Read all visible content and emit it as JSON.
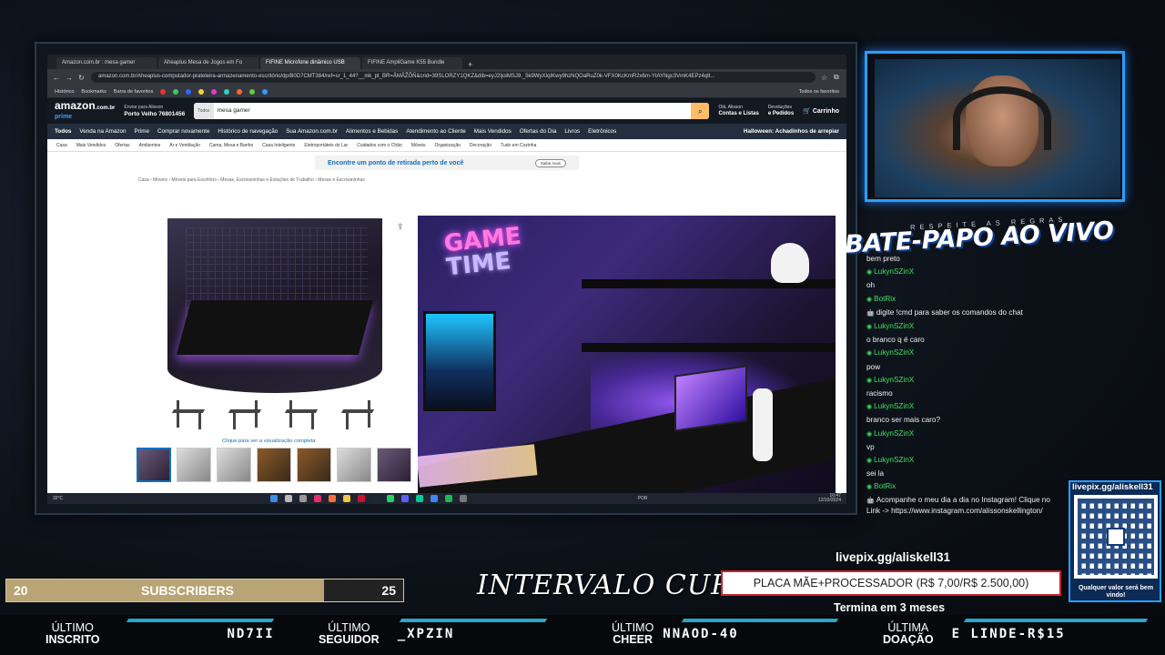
{
  "browser": {
    "tabs": [
      {
        "label": "Amazon.com.br : mesa gamer"
      },
      {
        "label": "Aheaplus Mesa de Jogos em Fo"
      },
      {
        "label": "FIFINE Microfone dinâmico USB"
      },
      {
        "label": "FIFINE AmpliGame K55 Bundle"
      }
    ],
    "url": "amazon.com.br/Aheaplus-computador-prateleira-armazenamento-escritório/dp/B0D7CMT384/ref=sr_1_44?__mk_pt_BR=ÅMÅŽÕÑ&crid=39SLORZY1QKZ&dib=eyJ2IjoiMSJ9._5k9WyXIqIKwy9hzNQOaRuZ0k-VFX0KcKmR2x6m-YtAYNgc3VmK4EPz4qIt...",
    "bookmarks": [
      "Histórico",
      "Bookmarks",
      "Barra de favoritos"
    ],
    "bookmarks_right": "Todos os favoritos"
  },
  "amazon": {
    "logo": "amazon",
    "logo_tld": ".com.br",
    "prime": "prime",
    "deliver_line1": "Enviar para Alisson",
    "deliver_line2": "Porto Velho 76801456",
    "search_category": "Todos",
    "search_value": "mesa gamer",
    "account_line1": "Olá, Alisson",
    "account_line2": "Contas e Listas",
    "returns_line1": "Devoluções",
    "returns_line2": "e Pedidos",
    "cart": "Carrinho",
    "nav": [
      "Todos",
      "Venda na Amazon",
      "Prime",
      "Comprar novamente",
      "Histórico de navegação",
      "Sua Amazon.com.br",
      "Alimentos e Bebidas",
      "Atendimento ao Cliente",
      "Mais Vendidos",
      "Ofertas do Dia",
      "Livros",
      "Eletrônicos"
    ],
    "nav_right": "Halloween: Achadinhos de arrepiar",
    "subnav": [
      "Casa",
      "Mais Vendidos",
      "Ofertas",
      "Ambientes",
      "Ar e Ventilação",
      "Cama, Mesa e Banho",
      "Casa Inteligente",
      "Eletroportáteis do Lar",
      "Cuidados com o Chão",
      "Móveis",
      "Organização",
      "Decoração",
      "Tudo em Cozinha"
    ],
    "banner_text": "Encontre um ponto de retirada perto de você",
    "banner_button": "Saiba mais",
    "breadcrumb": "Casa › Móveis › Móveis para Escritório › Mesas, Escrivaninhas e Estações de Trabalho › Mesas e Escrivaninhas",
    "view_link": "Clique para ver a visualização completa",
    "hero_neon_1": "GAME",
    "hero_neon_2": "TIME",
    "taskbar_temp": "32°C",
    "taskbar_time": "16:47",
    "taskbar_date": "12/10/2024",
    "taskbar_lang": "POR"
  },
  "chat": {
    "respeite": "RESPEITE AS REGRAS",
    "title": "BATE-PAPO AO VIVO",
    "messages": [
      {
        "user": "",
        "text": "bem preto"
      },
      {
        "user": "LukynSZinX",
        "text": "oh"
      },
      {
        "user": "BotRix",
        "text": "digite !cmd para saber os comandos do chat"
      },
      {
        "user": "LukynSZinX",
        "text": "o branco q é caro"
      },
      {
        "user": "LukynSZinX",
        "text": "pow"
      },
      {
        "user": "LukynSZinX",
        "text": "racismo"
      },
      {
        "user": "LukynSZinX",
        "text": "branco ser mais caro?"
      },
      {
        "user": "LukynSZinX",
        "text": "vp"
      },
      {
        "user": "LukynSZinX",
        "text": "sei la"
      },
      {
        "user": "BotRix",
        "text": "Acompanhe o meu dia a dia no Instagram! Clique no Link -> https://www.instagram.com/alissonskellington/"
      }
    ]
  },
  "livepix": {
    "title": "livepix.gg/aliskell31",
    "note": "Qualquer valor será bem vindo!"
  },
  "subs": {
    "current": "20",
    "label": "SUBSCRIBERS",
    "goal": "25",
    "progress": 0.8
  },
  "center": {
    "intervalo": "INTERVALO CURTO",
    "goal_link": "livepix.gg/aliskell31",
    "goal_text": "PLACA MÃE+PROCESSADOR (R$ 7,00/R$ 2.500,00)",
    "goal_ends": "Termina em 3 meses"
  },
  "bottom": [
    {
      "l1": "ÚLTIMO",
      "l2": "INSCRITO",
      "value": "ND7II"
    },
    {
      "l1": "ÚLTIMO",
      "l2": "SEGUIDOR",
      "value": "_XPZIN"
    },
    {
      "l1": "ÚLTIMO",
      "l2": "CHEER",
      "value": "NNAOD-40"
    },
    {
      "l1": "ÚLTIMA",
      "l2": "DOAÇÃO",
      "value": "E LINDE-R$15"
    }
  ],
  "colors": {
    "accent_blue": "#2a9eff",
    "chat_user": "#3ee062",
    "subs_fill": "#b8a474",
    "goal_border": "#c9222e"
  }
}
